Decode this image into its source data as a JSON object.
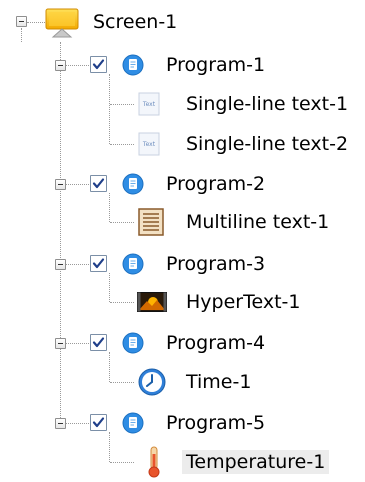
{
  "tree": {
    "root": {
      "label": "Screen-1",
      "icon": "screen-icon",
      "expanded": true
    },
    "programs": [
      {
        "label": "Program-1",
        "checked": true,
        "expanded": true,
        "icon": "program-icon",
        "children": [
          {
            "label": "Single-line text-1",
            "icon": "text-icon",
            "icon_text": "Text"
          },
          {
            "label": "Single-line text-2",
            "icon": "text-icon",
            "icon_text": "Text"
          }
        ]
      },
      {
        "label": "Program-2",
        "checked": true,
        "expanded": true,
        "icon": "program-icon",
        "children": [
          {
            "label": "Multiline text-1",
            "icon": "multiline-text-icon"
          }
        ]
      },
      {
        "label": "Program-3",
        "checked": true,
        "expanded": true,
        "icon": "program-icon",
        "children": [
          {
            "label": "HyperText-1",
            "icon": "hypertext-icon"
          }
        ]
      },
      {
        "label": "Program-4",
        "checked": true,
        "expanded": true,
        "icon": "program-icon",
        "children": [
          {
            "label": "Time-1",
            "icon": "clock-icon"
          }
        ]
      },
      {
        "label": "Program-5",
        "checked": true,
        "expanded": true,
        "icon": "program-icon",
        "children": [
          {
            "label": "Temperature-1",
            "icon": "thermometer-icon",
            "selected": true
          }
        ]
      }
    ]
  }
}
